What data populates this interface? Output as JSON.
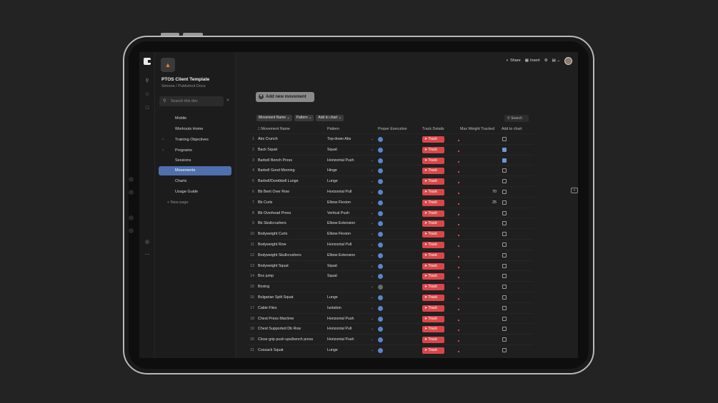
{
  "sidebar": {
    "doc_title": "PTOS Client Template",
    "doc_subtitle": "Simone / Published Docs",
    "search_placeholder": "Search this doc",
    "items": [
      {
        "label": "Mobile"
      },
      {
        "label": "Workouts Home"
      },
      {
        "label": "Training Objectives"
      },
      {
        "label": "Programs"
      },
      {
        "label": "Sessions"
      },
      {
        "label": "Movements"
      },
      {
        "label": "Charts"
      },
      {
        "label": "Usage Guide"
      },
      {
        "label": "+ New page"
      }
    ]
  },
  "topbar": {
    "share_label": "Share",
    "insert_label": "Insert"
  },
  "main": {
    "add_button_label": "Add new movement",
    "filters": [
      "Movement Name ⌄",
      "Pattern ⌄",
      "Add to chart ⌄"
    ],
    "table_search_label": "Search",
    "columns": [
      "Movement Name",
      "Pattern",
      "Proper Execution",
      "Track Details",
      "Max Weight Tracked",
      "Add to chart"
    ],
    "track_label": "Track",
    "rows": [
      {
        "n": "1",
        "name": "Abs Crunch",
        "pattern": "Top-down Abs",
        "weight": "",
        "checked": false,
        "exec": "blue"
      },
      {
        "n": "2",
        "name": "Back Squat",
        "pattern": "Squat",
        "weight": "",
        "checked": true,
        "exec": "blue"
      },
      {
        "n": "3",
        "name": "Barbell Bench Press",
        "pattern": "Horizontal Push",
        "weight": "",
        "checked": true,
        "exec": "blue"
      },
      {
        "n": "4",
        "name": "Barbell Good Morning",
        "pattern": "Hinge",
        "weight": "",
        "checked": false,
        "exec": "blue"
      },
      {
        "n": "5",
        "name": "Barbell/Dumbbell Lunge",
        "pattern": "Lunge",
        "weight": "",
        "checked": false,
        "exec": "blue"
      },
      {
        "n": "6",
        "name": "Bb Bent Over Row",
        "pattern": "Horizontal Pull",
        "weight": "70",
        "checked": false,
        "exec": "blue"
      },
      {
        "n": "7",
        "name": "Bb Curls",
        "pattern": "Elbow Flexion",
        "weight": "25",
        "checked": false,
        "exec": "blue"
      },
      {
        "n": "8",
        "name": "Bb Overhead Press",
        "pattern": "Vertical Push",
        "weight": "",
        "checked": false,
        "exec": "blue"
      },
      {
        "n": "9",
        "name": "Bb Skullcrushers",
        "pattern": "Elbow Extension",
        "weight": "",
        "checked": false,
        "exec": "blue"
      },
      {
        "n": "10",
        "name": "Bodyweight Curls",
        "pattern": "Elbow Flexion",
        "weight": "",
        "checked": false,
        "exec": "blue"
      },
      {
        "n": "11",
        "name": "Bodyweight Row",
        "pattern": "Horizontal Pull",
        "weight": "",
        "checked": false,
        "exec": "blue"
      },
      {
        "n": "12",
        "name": "Bodyweight Skullcrushers",
        "pattern": "Elbow Extension",
        "weight": "",
        "checked": false,
        "exec": "blue"
      },
      {
        "n": "13",
        "name": "Bodyweight Squat",
        "pattern": "Squat",
        "weight": "",
        "checked": false,
        "exec": "blue"
      },
      {
        "n": "14",
        "name": "Box jump",
        "pattern": "Squat",
        "weight": "",
        "checked": false,
        "exec": "blue"
      },
      {
        "n": "15",
        "name": "Boxing",
        "pattern": "",
        "weight": "",
        "checked": false,
        "exec": "gray"
      },
      {
        "n": "16",
        "name": "Bulgarian Split Squat",
        "pattern": "Lunge",
        "weight": "",
        "checked": false,
        "exec": "blue"
      },
      {
        "n": "17",
        "name": "Cable Flies",
        "pattern": "Isolation",
        "weight": "",
        "checked": false,
        "exec": "blue"
      },
      {
        "n": "18",
        "name": "Chest Press Machine",
        "pattern": "Horizontal Push",
        "weight": "",
        "checked": false,
        "exec": "blue"
      },
      {
        "n": "19",
        "name": "Chest Supported Db Row",
        "pattern": "Horizontal Pull",
        "weight": "",
        "checked": false,
        "exec": "blue"
      },
      {
        "n": "20",
        "name": "Close grip push ups/bench press",
        "pattern": "Horizontal Push",
        "weight": "",
        "checked": false,
        "exec": "blue"
      },
      {
        "n": "21",
        "name": "Cossack Squat",
        "pattern": "Lunge",
        "weight": "",
        "checked": false,
        "exec": "blue"
      }
    ]
  }
}
